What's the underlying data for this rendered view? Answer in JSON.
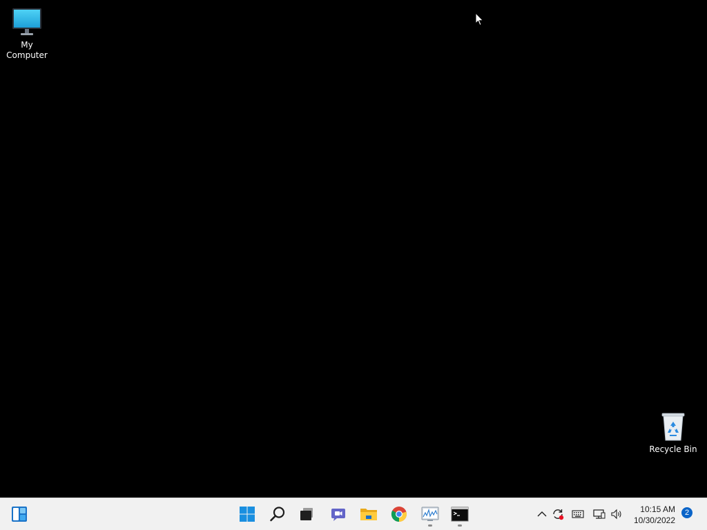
{
  "desktop": {
    "icons": [
      {
        "label": "My Computer",
        "icon": "monitor-icon"
      },
      {
        "label": "Recycle Bin",
        "icon": "recycle-bin-icon"
      }
    ]
  },
  "taskbar": {
    "items": [
      {
        "name": "widgets",
        "icon": "widgets-icon"
      },
      {
        "name": "start",
        "icon": "windows-logo-icon"
      },
      {
        "name": "search",
        "icon": "search-icon"
      },
      {
        "name": "task-view",
        "icon": "task-view-icon"
      },
      {
        "name": "chat",
        "icon": "chat-icon"
      },
      {
        "name": "file-explorer",
        "icon": "folder-icon"
      },
      {
        "name": "chrome",
        "icon": "chrome-icon"
      },
      {
        "name": "performance-monitor",
        "icon": "performance-monitor-icon",
        "running": true
      },
      {
        "name": "command-prompt",
        "icon": "command-prompt-icon",
        "running": true
      }
    ],
    "tray": {
      "icons": [
        "chevron-up-icon",
        "sync-icon",
        "keyboard-icon",
        "network-icon",
        "volume-icon"
      ],
      "time": "10:15 AM",
      "date": "10/30/2022",
      "notification_count": "2"
    }
  },
  "colors": {
    "desktop_background": "#000000",
    "taskbar_background": "#f1f1f1",
    "accent": "#0a64c8"
  }
}
